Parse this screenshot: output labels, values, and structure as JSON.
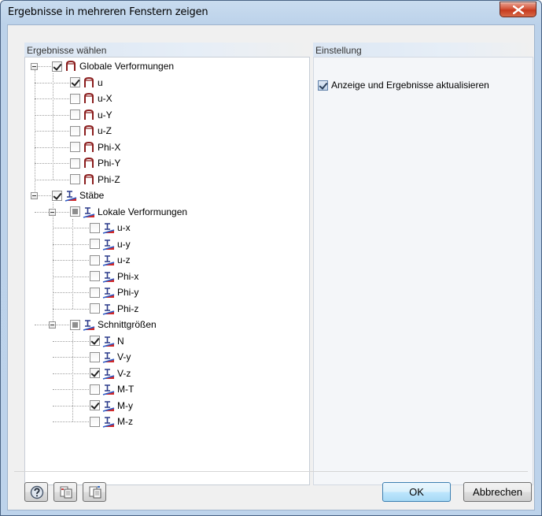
{
  "window": {
    "title": "Ergebnisse in mehreren Fenstern zeigen"
  },
  "left_panel": {
    "header": "Ergebnisse wählen",
    "tree": [
      {
        "label": "Globale Verformungen",
        "state": "checked",
        "icon": "deformation-icon",
        "level": 0
      },
      {
        "label": "u",
        "state": "checked",
        "icon": "deformation-icon",
        "level": 1
      },
      {
        "label": "u-X",
        "state": "unchecked",
        "icon": "deformation-icon",
        "level": 1
      },
      {
        "label": "u-Y",
        "state": "unchecked",
        "icon": "deformation-icon",
        "level": 1
      },
      {
        "label": "u-Z",
        "state": "unchecked",
        "icon": "deformation-icon",
        "level": 1
      },
      {
        "label": "Phi-X",
        "state": "unchecked",
        "icon": "deformation-icon",
        "level": 1
      },
      {
        "label": "Phi-Y",
        "state": "unchecked",
        "icon": "deformation-icon",
        "level": 1
      },
      {
        "label": "Phi-Z",
        "state": "unchecked",
        "icon": "deformation-icon",
        "level": 1
      },
      {
        "label": "Stäbe",
        "state": "checked",
        "icon": "member-icon",
        "level": 0
      },
      {
        "label": "Lokale Verformungen",
        "state": "partial",
        "icon": "member-icon",
        "level": 1
      },
      {
        "label": "u-x",
        "state": "unchecked",
        "icon": "member-icon",
        "level": 2
      },
      {
        "label": "u-y",
        "state": "unchecked",
        "icon": "member-icon",
        "level": 2
      },
      {
        "label": "u-z",
        "state": "unchecked",
        "icon": "member-icon",
        "level": 2
      },
      {
        "label": "Phi-x",
        "state": "unchecked",
        "icon": "member-icon",
        "level": 2
      },
      {
        "label": "Phi-y",
        "state": "unchecked",
        "icon": "member-icon",
        "level": 2
      },
      {
        "label": "Phi-z",
        "state": "unchecked",
        "icon": "member-icon",
        "level": 2
      },
      {
        "label": "Schnittgrößen",
        "state": "partial",
        "icon": "member-icon",
        "level": 1
      },
      {
        "label": "N",
        "state": "checked",
        "icon": "member-icon",
        "level": 2
      },
      {
        "label": "V-y",
        "state": "unchecked",
        "icon": "member-icon",
        "level": 2
      },
      {
        "label": "V-z",
        "state": "checked",
        "icon": "member-icon",
        "level": 2
      },
      {
        "label": "M-T",
        "state": "unchecked",
        "icon": "member-icon",
        "level": 2
      },
      {
        "label": "M-y",
        "state": "checked",
        "icon": "member-icon",
        "level": 2
      },
      {
        "label": "M-z",
        "state": "unchecked",
        "icon": "member-icon",
        "level": 2
      }
    ]
  },
  "right_panel": {
    "header": "Einstellung",
    "option_label": "Anzeige und Ergebnisse aktualisieren",
    "option_checked": true
  },
  "buttons": {
    "ok": "OK",
    "cancel": "Abbrechen",
    "tools": [
      "help-icon",
      "export-icon",
      "import-icon"
    ]
  },
  "colors": {
    "accent_red": "#c0392b",
    "accent_blue": "#2a5cc8",
    "close_red": "#c63a1f"
  }
}
